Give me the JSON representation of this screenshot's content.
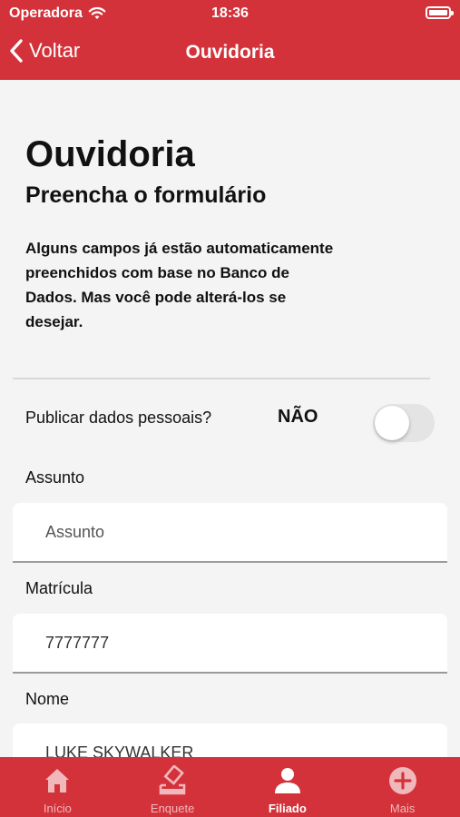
{
  "status": {
    "carrier": "Operadora",
    "time": "18:36"
  },
  "nav": {
    "back_label": "Voltar",
    "title": "Ouvidoria"
  },
  "content": {
    "title": "Ouvidoria",
    "subtitle": "Preencha o formulário",
    "info_line1": "Alguns campos já estão automaticamente",
    "info_line2": "preenchidos com base no Banco de",
    "info_line3": "Dados. Mas você pode alterá-los se",
    "info_line4": "desejar."
  },
  "publish": {
    "label": "Publicar dados pessoais?",
    "state": "NÃO",
    "enabled": false
  },
  "fields": {
    "assunto": {
      "label": "Assunto",
      "value": "",
      "placeholder": "Assunto"
    },
    "matricula": {
      "label": "Matrícula",
      "value": "7777777"
    },
    "nome": {
      "label": "Nome",
      "value": "LUKE SKYWALKER"
    }
  },
  "tabs": {
    "inicio": "Início",
    "enquete": "Enquete",
    "filiado": "Filiado",
    "mais": "Mais",
    "active": "Filiado"
  },
  "colors": {
    "brand": "#d4323a",
    "background": "#f4f4f4",
    "tab_inactive": "#f0b8bb"
  },
  "icons": [
    "wifi-icon",
    "battery-icon",
    "chevron-left-icon",
    "home-icon",
    "ballot-icon",
    "person-icon",
    "plus-circle-icon"
  ]
}
